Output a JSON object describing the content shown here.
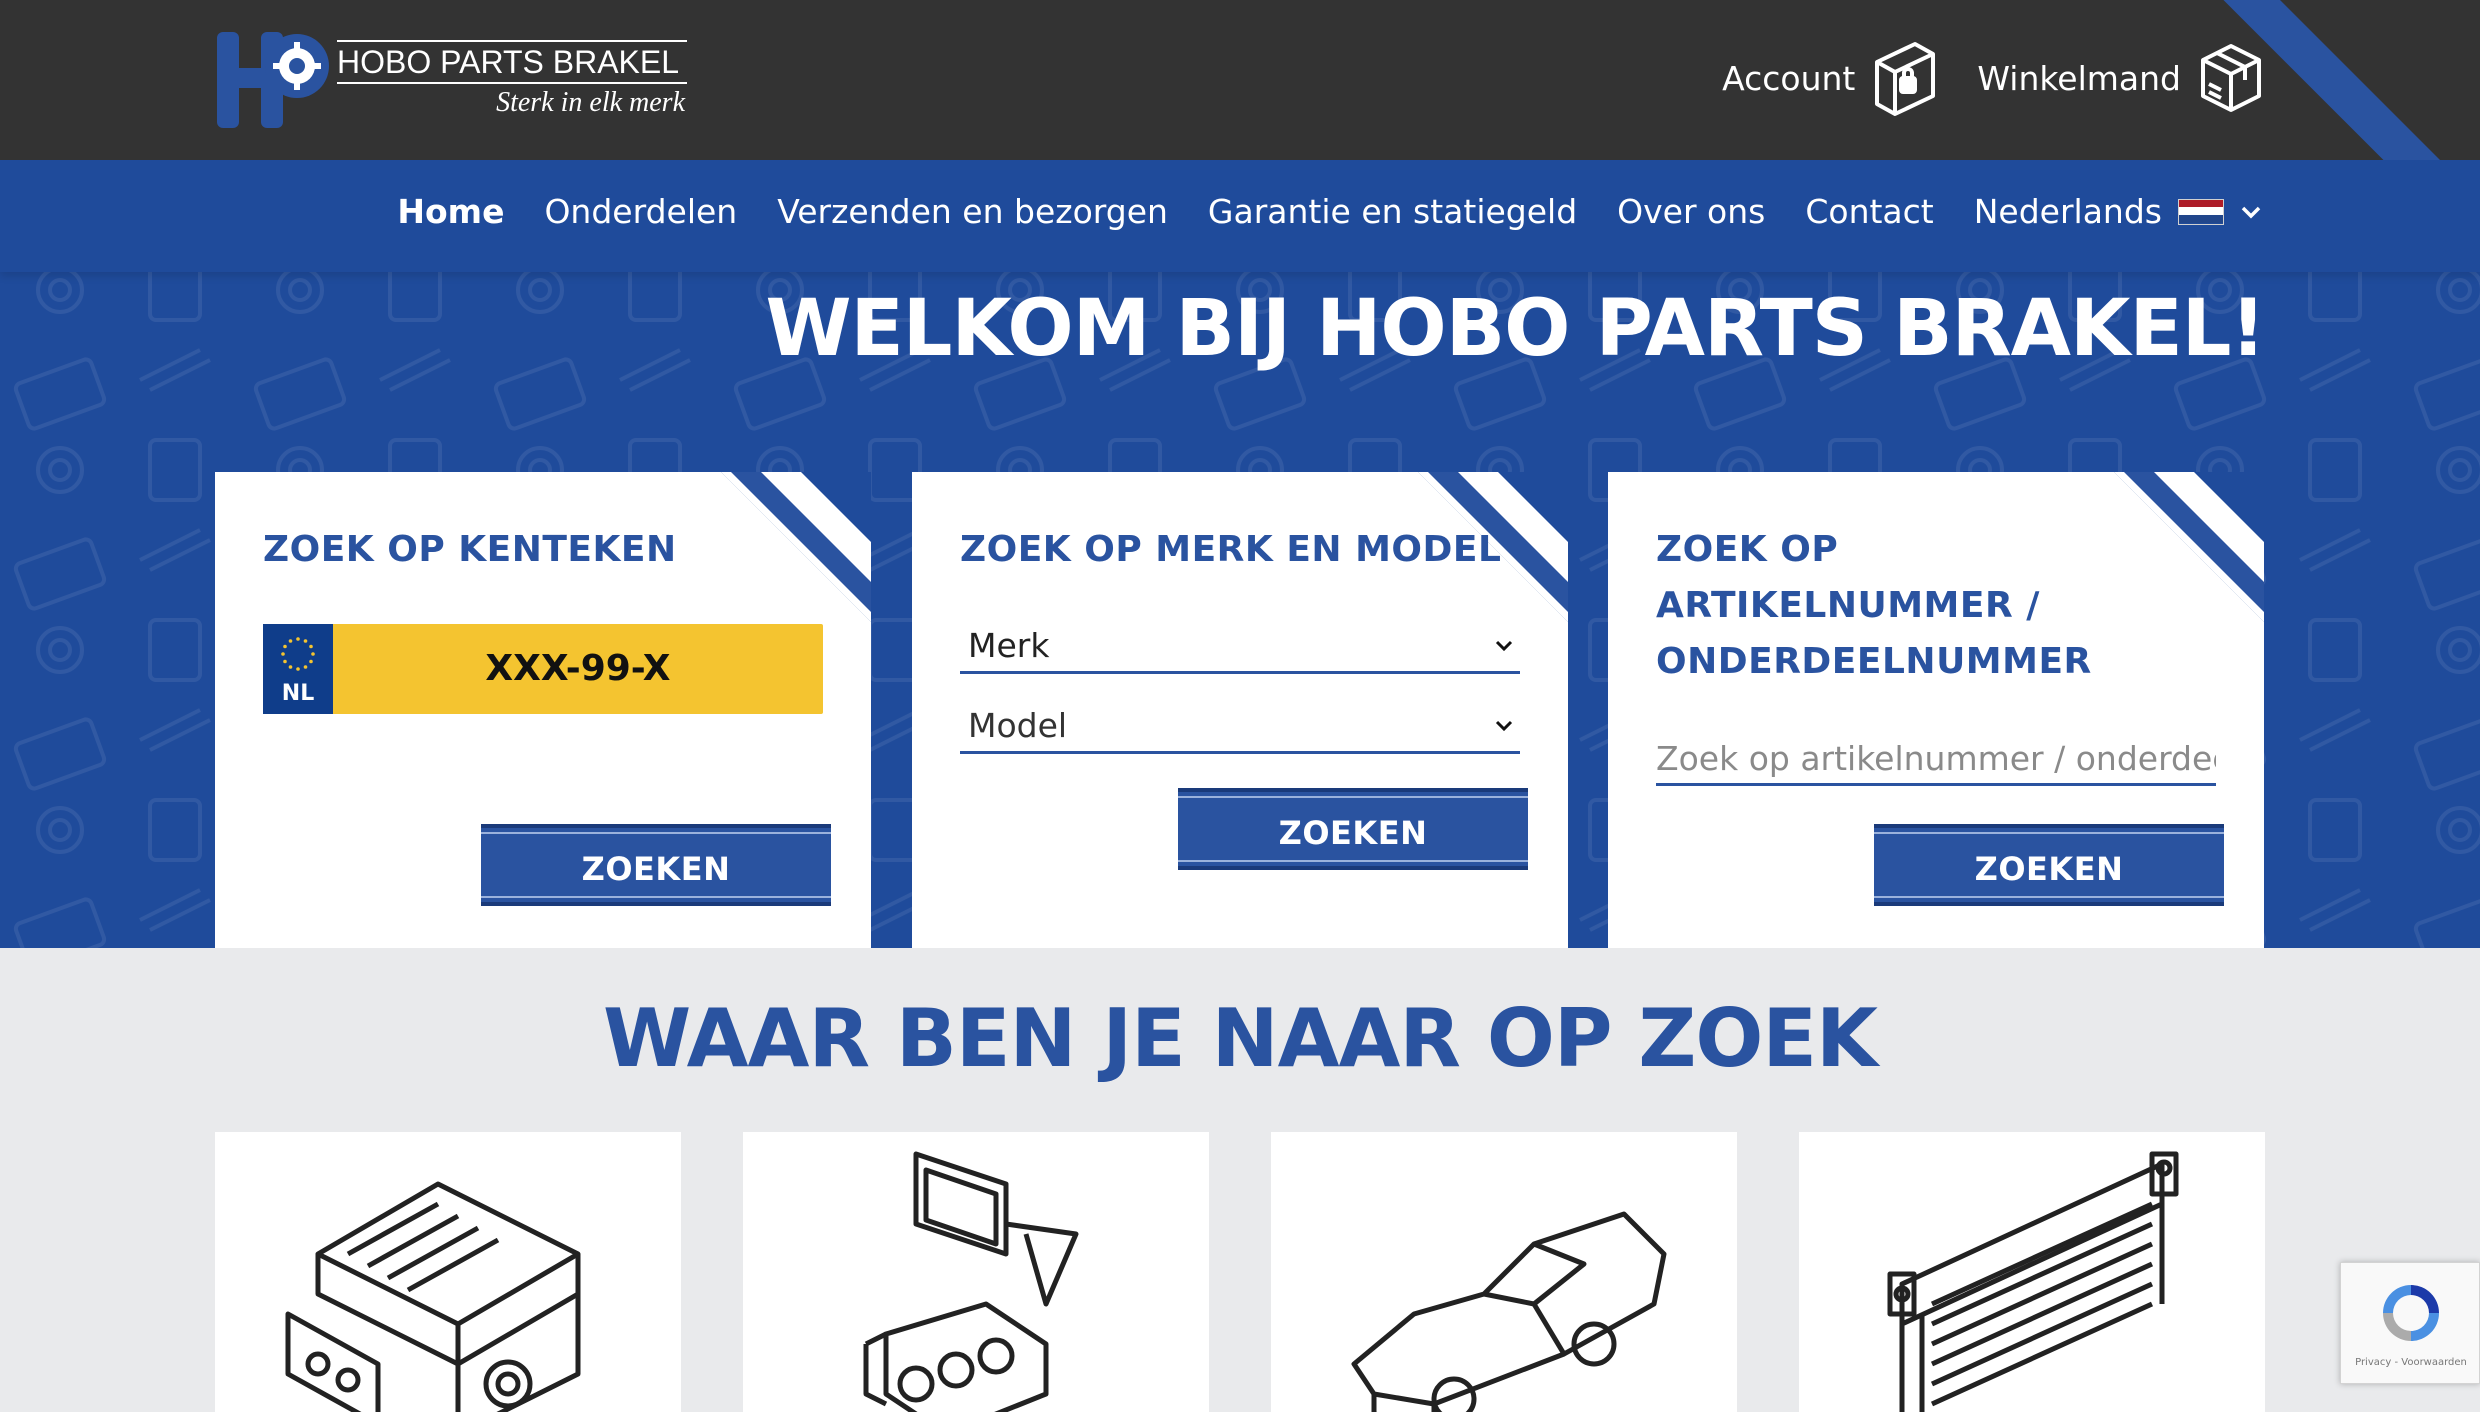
{
  "logo": {
    "title": "HOBO PARTS BRAKEL",
    "tagline": "Sterk in elk merk"
  },
  "header_links": [
    {
      "label": "Account",
      "icon": "lock-icon"
    },
    {
      "label": "Winkelmand",
      "icon": "box-icon"
    }
  ],
  "nav": {
    "items": [
      "Home",
      "Onderdelen",
      "Verzenden en bezorgen",
      "Garantie en statiegeld",
      "Over ons",
      "Contact"
    ],
    "active": "Home",
    "language": "Nederlands"
  },
  "hero": {
    "title": "WELKOM BIJ HOBO PARTS BRAKEL!"
  },
  "search_cards": {
    "plate": {
      "title": "ZOEK OP KENTEKEN",
      "country": "NL",
      "plate_value": "XXX-99-X",
      "button": "ZOEKEN"
    },
    "brand_model": {
      "title": "ZOEK OP MERK EN MODEL",
      "brand_select": "Merk",
      "model_select": "Model",
      "button": "ZOEKEN"
    },
    "article": {
      "title": "ZOEK OP ARTIKELNUMMER / ONDERDEELNUMMER",
      "title_lines": [
        "ZOEK OP",
        "ARTIKELNUMMER /",
        "ONDERDEELNUMMER"
      ],
      "placeholder": "Zoek op artikelnummer / onderdeelnummer",
      "button": "ZOEKEN"
    }
  },
  "categories": {
    "title": "WAAR BEN JE NAAR OP ZOEK",
    "tiles": [
      {
        "icon": "engine-icon"
      },
      {
        "icon": "mirror-and-cylinder-head-icon"
      },
      {
        "icon": "car-body-icon"
      },
      {
        "icon": "radiator-icon"
      }
    ]
  },
  "recaptcha": {
    "text": "Privacy - Voorwaarden"
  },
  "colors": {
    "topbar": "#333333",
    "brand_blue": "#1f4b9b",
    "accent_blue": "#2a53a0",
    "plate_yellow": "#f4c430",
    "background": "#e9eaec"
  }
}
